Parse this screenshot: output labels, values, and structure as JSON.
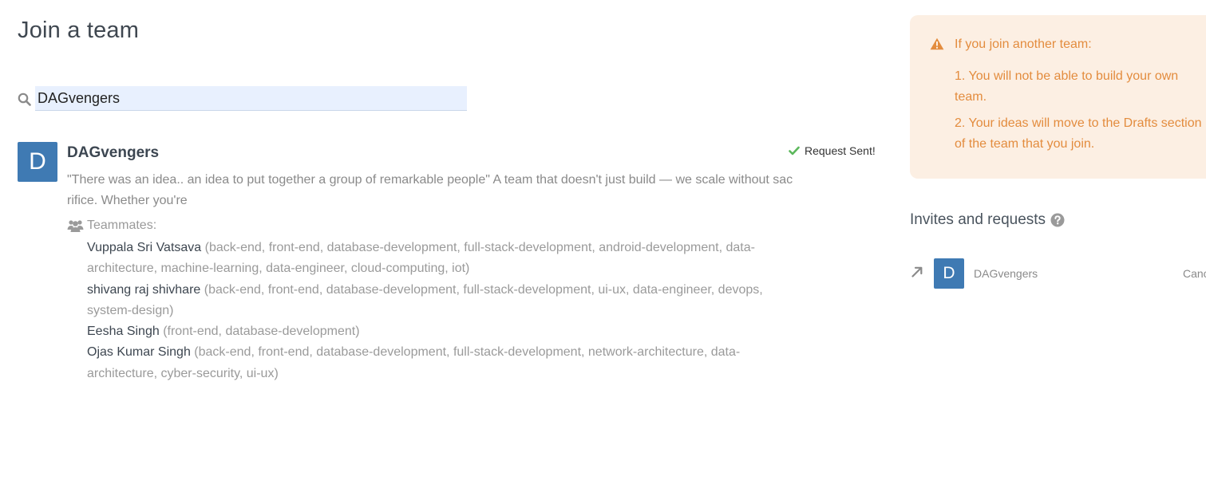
{
  "page": {
    "title": "Join a team"
  },
  "search": {
    "value": "DAGvengers"
  },
  "team": {
    "avatar_letter": "D",
    "name": "DAGvengers",
    "request_status": "Request Sent!",
    "description": "\"There was an idea.. an idea to put together a group of remarkable people\" A team that doesn't just build — we scale without sacrifice. Whether you're",
    "teammates_label": "Teammates:",
    "members": [
      {
        "name": "Vuppala Sri Vatsava",
        "skills": "(back-end, front-end, database-development, full-stack-development, android-development, data-architecture, machine-learning, data-engineer, cloud-computing, iot)"
      },
      {
        "name": "shivang raj shivhare",
        "skills": "(back-end, front-end, database-development, full-stack-development, ui-ux, data-engineer, devops, system-design)"
      },
      {
        "name": "Eesha Singh",
        "skills": "(front-end, database-development)"
      },
      {
        "name": "Ojas Kumar Singh",
        "skills": "(back-end, front-end, database-development, full-stack-development, network-architecture, data-architecture, cyber-security, ui-ux)"
      }
    ]
  },
  "warning": {
    "title": "If you join another team:",
    "items": [
      "1. You will not be able to build your own team.",
      "2. Your ideas will move to the Drafts section of the team that you join."
    ]
  },
  "invites": {
    "title": "Invites and requests",
    "rows": [
      {
        "avatar_letter": "D",
        "name": "DAGvengers",
        "action": "Cancel"
      }
    ]
  },
  "colors": {
    "accent_blue": "#3f7ab3",
    "warning_bg": "#fcefe3",
    "warning_text": "#e38c3e",
    "check_green": "#5cb85c"
  },
  "icons": {
    "search": "search-icon",
    "check": "check-icon",
    "group": "group-icon",
    "warning": "warning-icon",
    "help": "help-icon",
    "arrow": "arrow-icon"
  }
}
